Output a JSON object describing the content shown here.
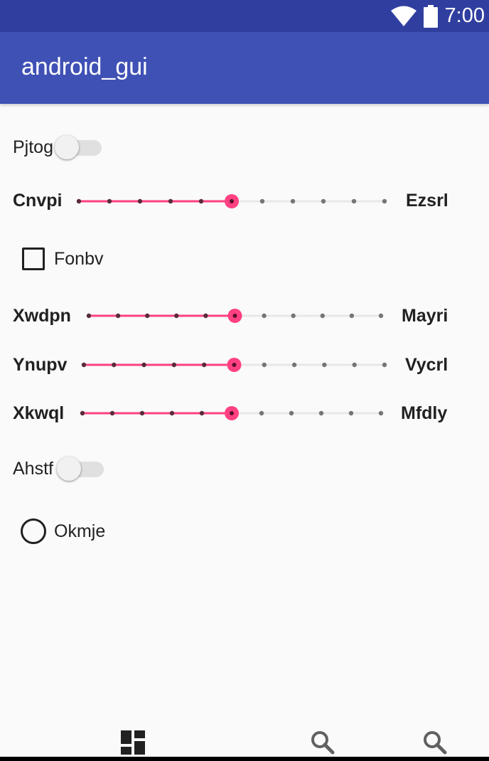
{
  "status_bar": {
    "time": "7:00",
    "icons": [
      "wifi-icon",
      "battery-icon"
    ]
  },
  "app_bar": {
    "title": "android_gui"
  },
  "colors": {
    "primary": "#3f51b5",
    "primary_dark": "#303f9f",
    "accent": "#ff4081"
  },
  "controls": {
    "switch_1": {
      "label": "Pjtog",
      "checked": false
    },
    "slider_1": {
      "left_label": "Cnvpi",
      "right_label": "Ezsrl",
      "steps": 10,
      "value": 5
    },
    "checkbox_1": {
      "label": "Fonbv",
      "checked": false
    },
    "slider_2": {
      "left_label": "Xwdpn",
      "right_label": "Mayri",
      "steps": 10,
      "value": 5
    },
    "slider_3": {
      "left_label": "Ynupv",
      "right_label": "Vycrl",
      "steps": 10,
      "value": 5
    },
    "slider_4": {
      "left_label": "Xkwql",
      "right_label": "Mfdly",
      "steps": 10,
      "value": 5
    },
    "switch_2": {
      "label": "Ahstf",
      "checked": false
    },
    "radio_1": {
      "label": "Okmje",
      "checked": false
    }
  },
  "bottom_nav": {
    "items": [
      "dashboard-icon",
      "search-icon",
      "search-icon"
    ],
    "selected": 0
  }
}
